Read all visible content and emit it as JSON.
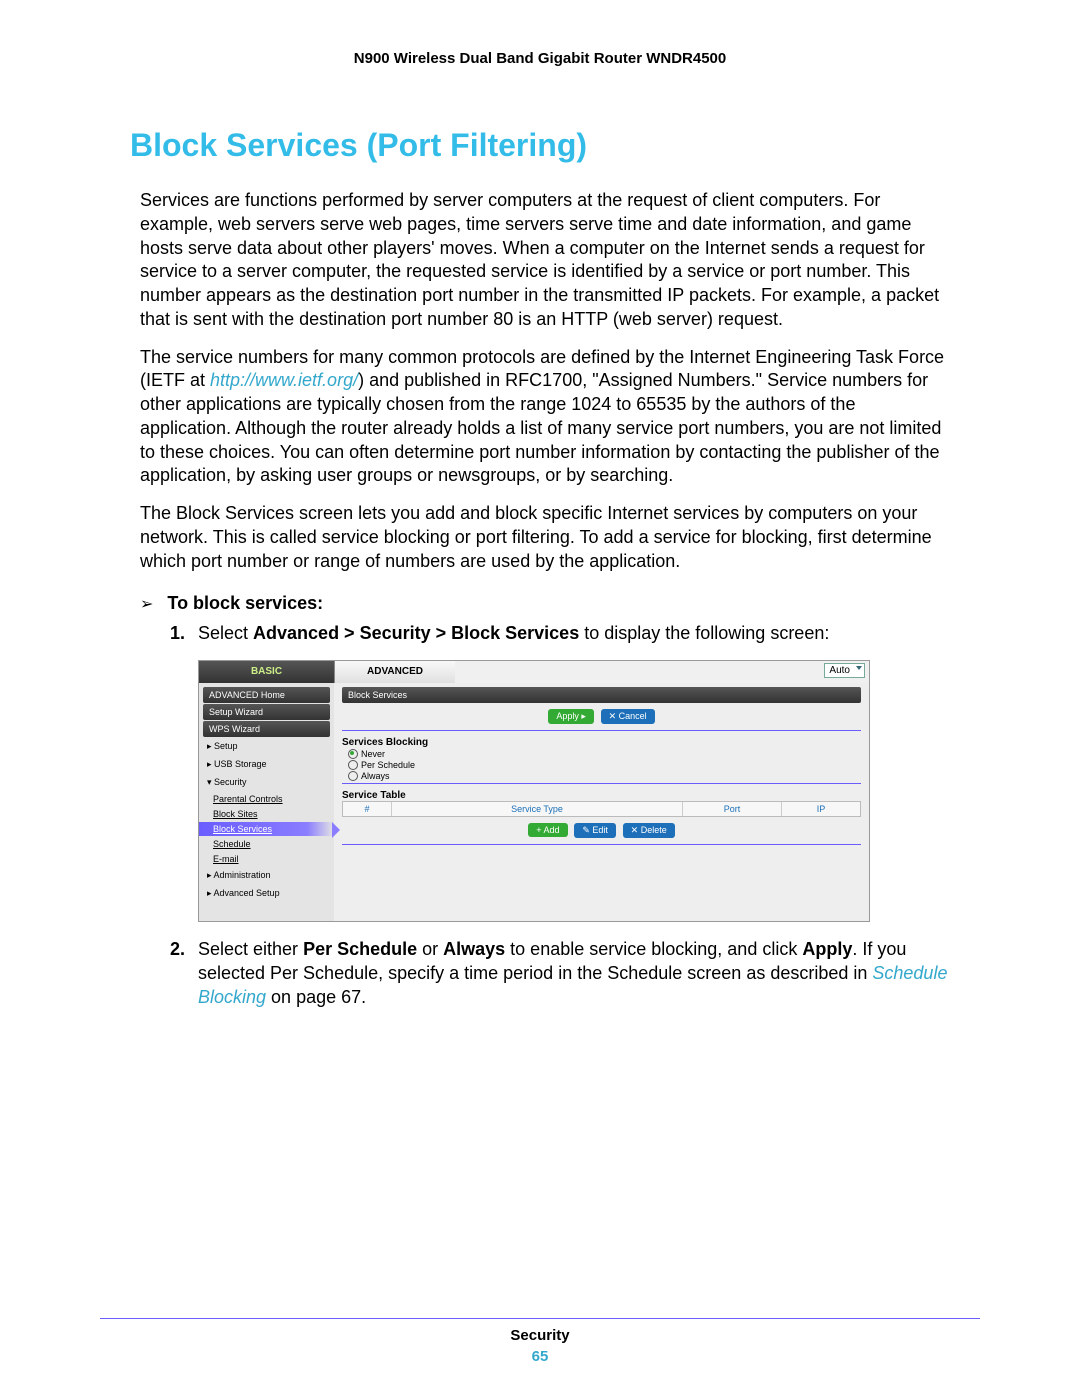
{
  "header": "N900 Wireless Dual Band Gigabit Router WNDR4500",
  "title": "Block Services (Port Filtering)",
  "para1": "Services are functions performed by server computers at the request of client computers. For example, web servers serve web pages, time servers serve time and date information, and game hosts serve data about other players' moves. When a computer on the Internet sends a request for service to a server computer, the requested service is identified by a service or port number. This number appears as the destination port number in the transmitted IP packets. For example, a packet that is sent with the destination port number 80 is an HTTP (web server) request.",
  "para2_pre": "The service numbers for many common protocols are defined by the Internet Engineering Task Force (IETF at ",
  "para2_link": "http://www.ietf.org/",
  "para2_post": ") and published in RFC1700, \"Assigned Numbers.\" Service numbers for other applications are typically chosen from the range 1024 to 65535 by the authors of the application. Although the router already holds a list of many service port numbers, you are not limited to these choices. You can often determine port number information by contacting the publisher of the application, by asking user groups or newsgroups, or by searching.",
  "para3": "The Block Services screen lets you add and block specific Internet services by computers on your network. This is called service blocking or port filtering. To add a service for blocking, first determine which port number or range of numbers are used by the application.",
  "task_arrow": "➢",
  "task_label": "To block services:",
  "step1_num": "1.",
  "step1_pre": "Select ",
  "step1_bold": "Advanced > Security > Block Services",
  "step1_post": " to display the following screen:",
  "step2_num": "2.",
  "step2_pre": "Select either ",
  "step2_b1": "Per Schedule",
  "step2_mid1": " or ",
  "step2_b2": "Always",
  "step2_mid2": " to enable service blocking, and click ",
  "step2_b3": "Apply",
  "step2_mid3": ". If you selected Per Schedule, specify a time period in the Schedule screen as described in ",
  "step2_link": "Schedule Blocking",
  "step2_post": " on page 67.",
  "shot": {
    "tab_basic": "BASIC",
    "tab_adv": "ADVANCED",
    "auto": "Auto",
    "menu": {
      "home": "ADVANCED Home",
      "setup_wizard": "Setup Wizard",
      "wps": "WPS Wizard",
      "setup": "▸ Setup",
      "usb": "▸ USB Storage",
      "security": "▾ Security",
      "parental": "Parental Controls",
      "block_sites": "Block Sites",
      "block_services": "Block Services",
      "schedule": "Schedule",
      "email": "E-mail",
      "admin": "▸ Administration",
      "adv_setup": "▸ Advanced Setup"
    },
    "pane_title": "Block Services",
    "btn_apply": "Apply ▸",
    "btn_cancel": "✕ Cancel",
    "sect_blocking": "Services Blocking",
    "opt_never": "Never",
    "opt_per": "Per Schedule",
    "opt_always": "Always",
    "sect_table": "Service Table",
    "col_hash": "#",
    "col_type": "Service Type",
    "col_port": "Port",
    "col_ip": "IP",
    "btn_add": "+ Add",
    "btn_edit": "✎ Edit",
    "btn_delete": "✕ Delete"
  },
  "footer_label": "Security",
  "footer_page": "65"
}
